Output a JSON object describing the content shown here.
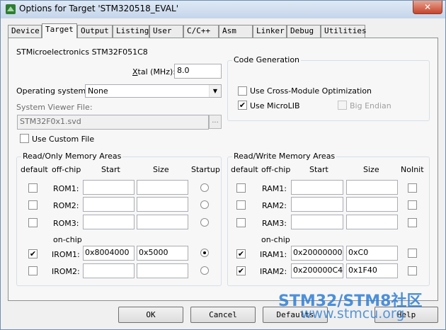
{
  "window": {
    "title": "Options for Target 'STM320518_EVAL'",
    "close": "✕"
  },
  "tabs": [
    "Device",
    "Target",
    "Output",
    "Listing",
    "User",
    "C/C++",
    "Asm",
    "Linker",
    "Debug",
    "Utilities"
  ],
  "target": {
    "device_name": "STMicroelectronics STM32F051C8",
    "xtal_label_x": "X",
    "xtal_label_rest": "tal (MHz):",
    "xtal_value": "8.0",
    "os_label": "Operating system:",
    "os_value": "None",
    "svf_label": "System Viewer File:",
    "svf_value": "STM32F0x1.svd",
    "browse": "...",
    "custom_file_label": "Use Custom File"
  },
  "codegen": {
    "title": "Code Generation",
    "cross_module": "Use Cross-Module Optimization",
    "microlib": "Use MicroLIB",
    "big_endian": "Big Endian"
  },
  "rom": {
    "title": "Read/Only Memory Areas",
    "headers": {
      "default": "default",
      "offchip": "off-chip",
      "start": "Start",
      "size": "Size",
      "startup": "Startup"
    },
    "onchip": "on-chip",
    "rows": [
      {
        "label": "ROM1:",
        "start": "",
        "size": "",
        "default": false,
        "startup": false
      },
      {
        "label": "ROM2:",
        "start": "",
        "size": "",
        "default": false,
        "startup": false
      },
      {
        "label": "ROM3:",
        "start": "",
        "size": "",
        "default": false,
        "startup": false
      },
      {
        "label": "IROM1:",
        "start": "0x8004000",
        "size": "0x5000",
        "default": true,
        "startup": true
      },
      {
        "label": "IROM2:",
        "start": "",
        "size": "",
        "default": false,
        "startup": false
      }
    ]
  },
  "ram": {
    "title": "Read/Write Memory Areas",
    "headers": {
      "default": "default",
      "offchip": "off-chip",
      "start": "Start",
      "size": "Size",
      "noinit": "NoInit"
    },
    "onchip": "on-chip",
    "rows": [
      {
        "label": "RAM1:",
        "start": "",
        "size": "",
        "default": false,
        "noinit": false
      },
      {
        "label": "RAM2:",
        "start": "",
        "size": "",
        "default": false,
        "noinit": false
      },
      {
        "label": "RAM3:",
        "start": "",
        "size": "",
        "default": false,
        "noinit": false
      },
      {
        "label": "IRAM1:",
        "start": "0x20000000",
        "size": "0xC0",
        "default": true,
        "noinit": false
      },
      {
        "label": "IRAM2:",
        "start": "0x200000C4",
        "size": "0x1F40",
        "default": true,
        "noinit": false
      }
    ]
  },
  "buttons": {
    "ok": "OK",
    "cancel": "Cancel",
    "defaults": "Defaults",
    "help": "Help"
  },
  "watermark": {
    "line1": "STM32/STM8社区",
    "line2": "www.stmcu.org"
  },
  "check_glyph": "✔"
}
